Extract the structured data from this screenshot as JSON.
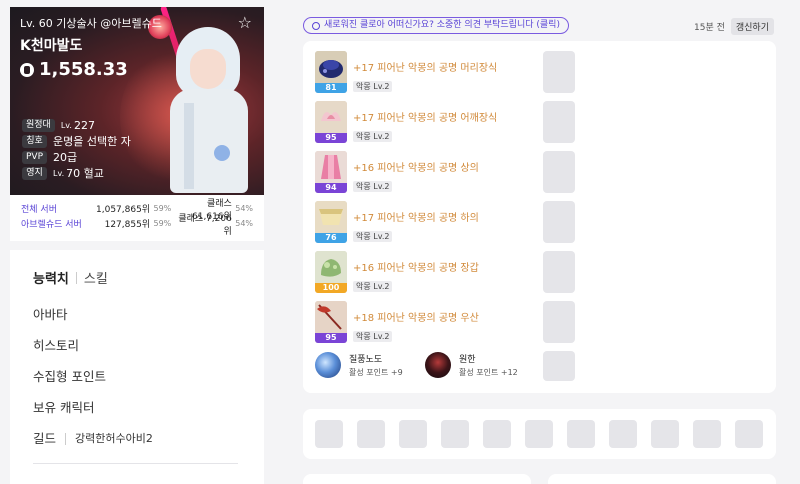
{
  "profile": {
    "header": "Lv. 60 기상술사 @아브렐슈드",
    "name": "K천마발도",
    "power": "1,558.33",
    "stats": [
      {
        "label": "원정대",
        "lv": "Lv.",
        "value": "227"
      },
      {
        "label": "칭호",
        "lv": "",
        "value": "운명을 선택한 자"
      },
      {
        "label": "PVP",
        "lv": "",
        "value": "20급"
      },
      {
        "label": "영지",
        "lv": "Lv.",
        "value": "70 혈교"
      }
    ]
  },
  "ranks": [
    {
      "label": "전체 서버",
      "rank": "1,057,865위",
      "pct": "59%",
      "class_rank": "클래스 61,616위",
      "class_pct": "54%"
    },
    {
      "label": "아브렐슈드 서버",
      "rank": "127,855위",
      "pct": "59%",
      "class_rank": "클래스 7,206위",
      "class_pct": "54%"
    }
  ],
  "menu": {
    "tab_active": "능력치",
    "tab_other": "스킬",
    "items": [
      "아바타",
      "히스토리",
      "수집형 포인트",
      "보유 캐릭터"
    ],
    "guild_label": "길드",
    "guild_name": "강력한허수아비2"
  },
  "notice": "새로워진 클로아 어떠신가요? 소중한 의견 부탁드립니다 (클릭)",
  "updated": "15분 전",
  "refresh_label": "갱신하기",
  "equipment": [
    {
      "name": "+17 피어난 악몽의 공명 머리장식",
      "tag": "악몽 Lv.2",
      "quality": "81",
      "bar_color": "#3fa3e6",
      "art": "helm"
    },
    {
      "name": "+17 피어난 악몽의 공명 어깨장식",
      "tag": "악몽 Lv.2",
      "quality": "95",
      "bar_color": "#7a44d6",
      "art": "shoulder"
    },
    {
      "name": "+16 피어난 악몽의 공명 상의",
      "tag": "악몽 Lv.2",
      "quality": "94",
      "bar_color": "#7a44d6",
      "art": "top"
    },
    {
      "name": "+17 피어난 악몽의 공명 하의",
      "tag": "악몽 Lv.2",
      "quality": "76",
      "bar_color": "#3fa3e6",
      "art": "bottom"
    },
    {
      "name": "+16 피어난 악몽의 공명 장갑",
      "tag": "악몽 Lv.2",
      "quality": "100",
      "bar_color": "#f2a825",
      "art": "glove"
    },
    {
      "name": "+18 피어난 악몽의 공명 우산",
      "tag": "악몽 Lv.2",
      "quality": "95",
      "bar_color": "#7a44d6",
      "art": "umbrella"
    }
  ],
  "runes": [
    {
      "name": "질풍노도",
      "point": "활성 포인트 +9"
    },
    {
      "name": "원한",
      "point": "활성 포인트 +12"
    }
  ]
}
